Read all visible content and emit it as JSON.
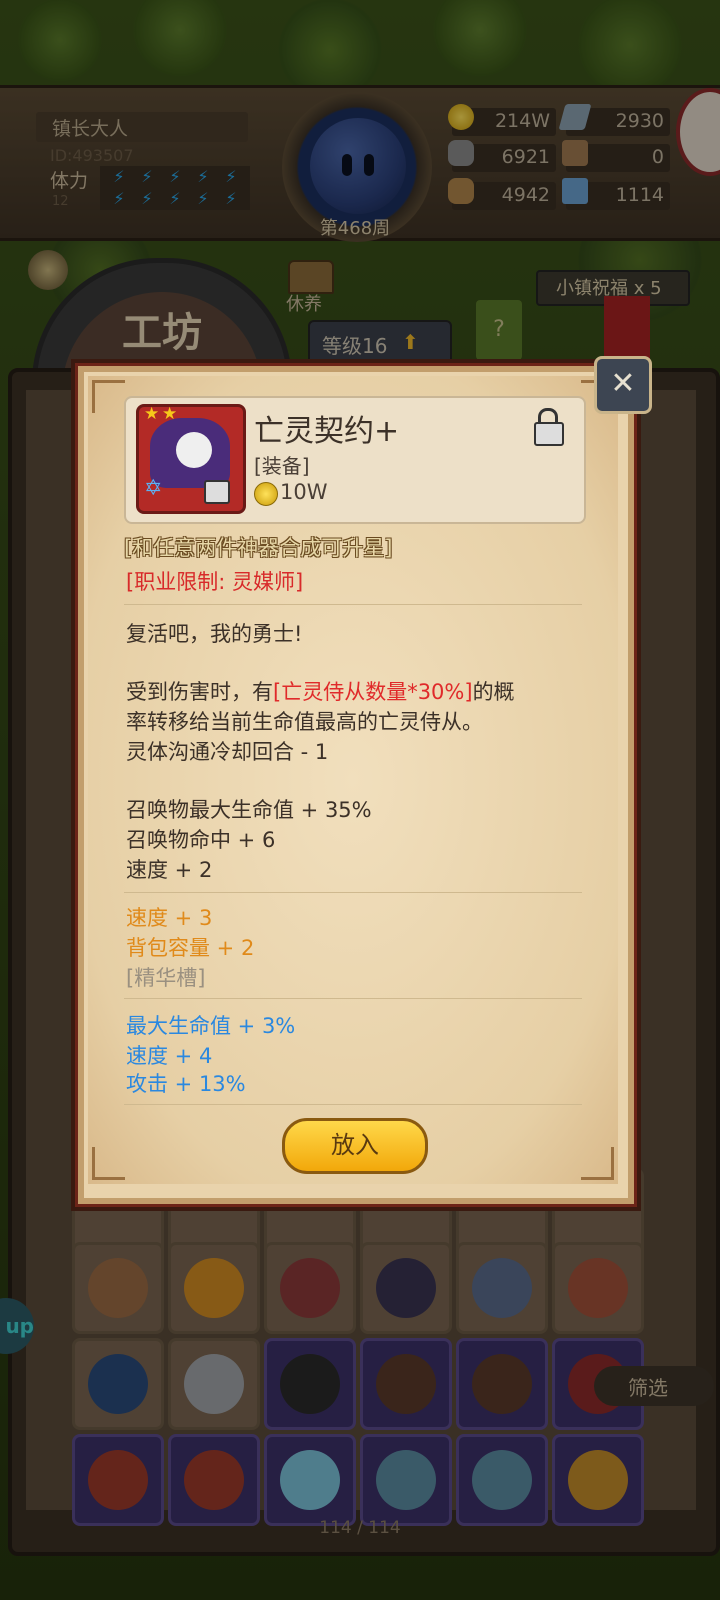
{
  "player": {
    "name": "镇长大人",
    "id": "ID:493507",
    "stamina_label": "体力",
    "stamina_level": "12"
  },
  "week": "第468周",
  "resources": [
    {
      "icon": "gold-coin-icon",
      "value": "214W"
    },
    {
      "icon": "iron-ingot-icon",
      "value": "2930"
    },
    {
      "icon": "stone-icon",
      "value": "6921"
    },
    {
      "icon": "leather-icon",
      "value": "0"
    },
    {
      "icon": "wood-log-icon",
      "value": "4942"
    },
    {
      "icon": "crystal-icon",
      "value": "1114"
    }
  ],
  "tabs": {
    "workshop": "工坊",
    "rest": "休养",
    "level": "等级16",
    "help": "?",
    "blessing": "小镇祝福 x 5"
  },
  "modal": {
    "title": "亡灵契约+",
    "type": "[装备]",
    "price": "10W",
    "upgrade_note": "[和任意两件神器合成可升星]",
    "class_limit": "[职业限制: 灵媒师]",
    "flavor": "复活吧，我的勇士!",
    "effect_pre": "受到伤害时，有",
    "effect_highlight": "[亡灵侍从数量*30%]",
    "effect_post": "的概",
    "effect_line2": "率转移给当前生命值最高的亡灵侍从。",
    "effect_line3": "灵体沟通冷却回合 - 1",
    "base_stats": [
      "召唤物最大生命值 + 35%",
      "召唤物命中 + 6",
      "速度 + 2"
    ],
    "bonus_stats": [
      "速度 + 3",
      "背包容量 + 2"
    ],
    "essence_slot": "[精华槽]",
    "random_stats": [
      "最大生命值 + 3%",
      "速度 + 4",
      "攻击 + 13%"
    ],
    "put_button": "放入"
  },
  "inventory": {
    "count": "114 / 114",
    "filter": "筛选",
    "side_badge": "up"
  },
  "colors": {
    "accent_red": "#e02a2a",
    "bonus_orange": "#e08a1a",
    "random_blue": "#2a88e0",
    "button_gold": "#f2a80a"
  }
}
